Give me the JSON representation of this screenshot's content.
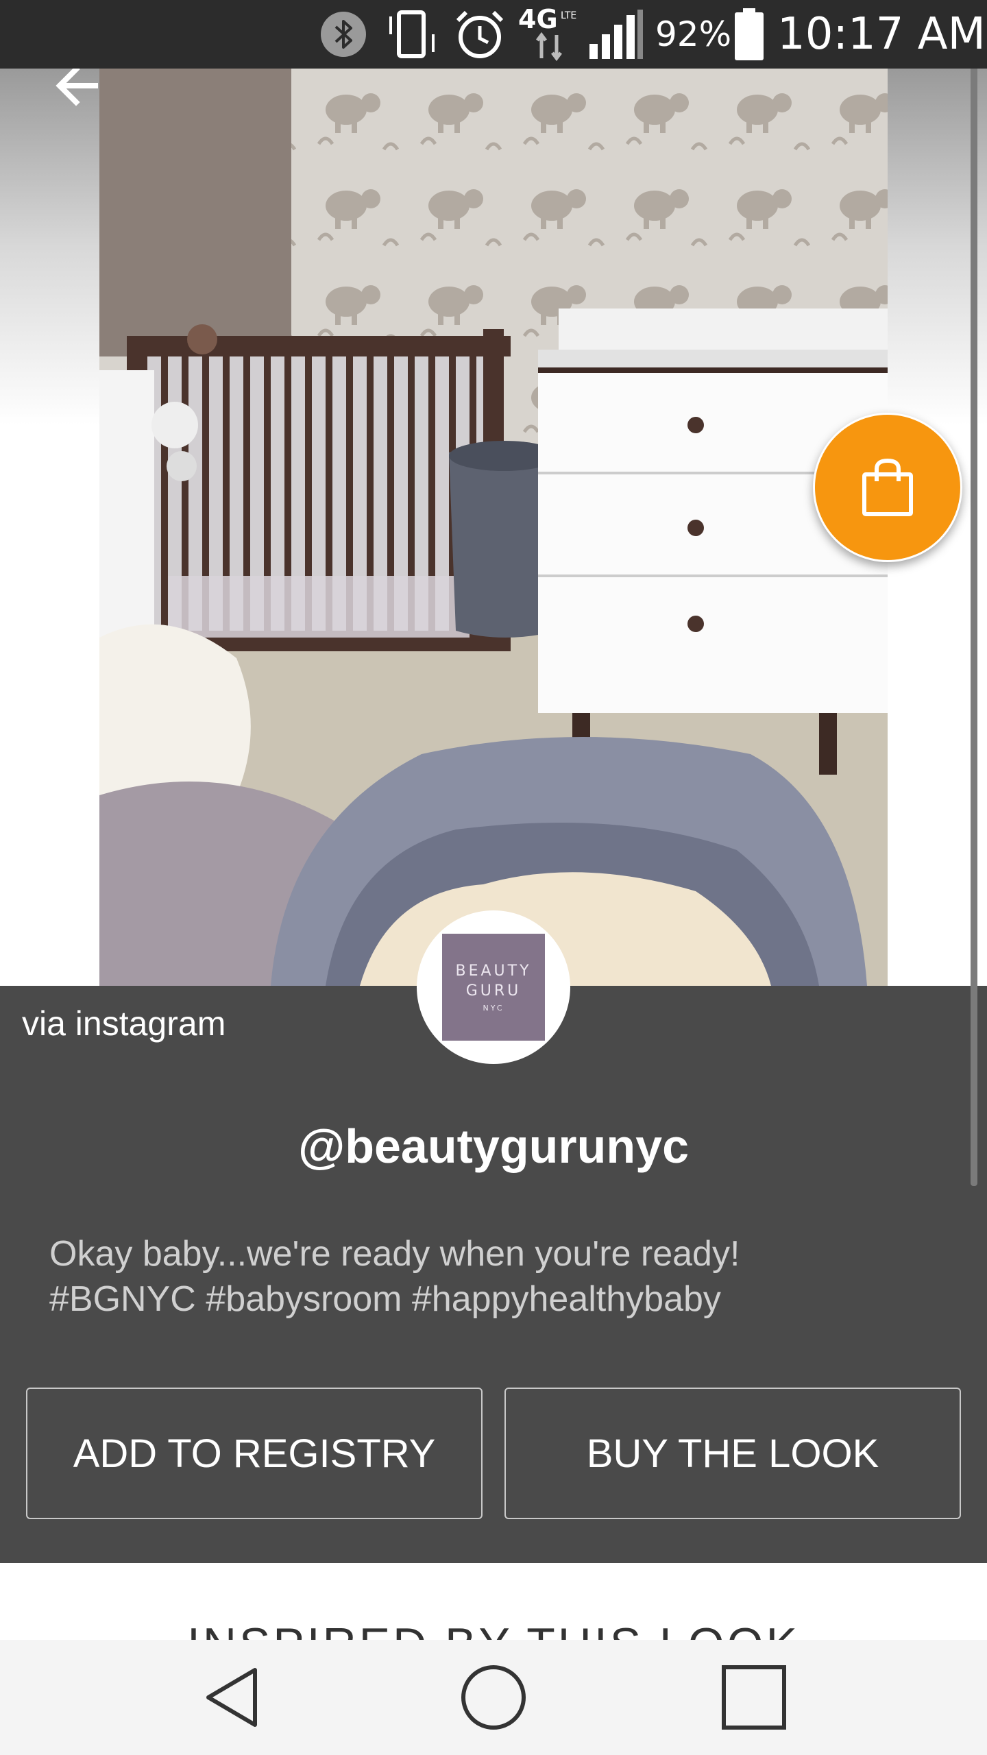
{
  "status_bar": {
    "battery": "92%",
    "time": "10:17 AM",
    "network": "4G LTE",
    "icons": [
      "bluetooth-icon",
      "vibrate-icon",
      "alarm-icon",
      "lte-icon",
      "signal-icon",
      "battery-icon"
    ]
  },
  "header": {
    "back_icon": "arrow-left-icon"
  },
  "cart_fab": {
    "icon": "shopping-bag-icon",
    "color": "#f7960f"
  },
  "post": {
    "source": "via instagram",
    "avatar": {
      "line1": "BEAUTY",
      "line2": "GURU",
      "line3": "NYC"
    },
    "handle": "@beautygurunyc",
    "caption_line1": "Okay baby...we're ready when you're ready!",
    "caption_line2": "#BGNYC #babysroom #happyhealthybaby"
  },
  "actions": {
    "add_to_registry": "ADD TO REGISTRY",
    "buy_the_look": "BUY THE LOOK"
  },
  "section": {
    "title": "INSPIRED BY THIS LOOK"
  },
  "colors": {
    "accent": "#f7960f",
    "panel": "#4a4a4a",
    "status_bar": "#2c2c2c"
  }
}
